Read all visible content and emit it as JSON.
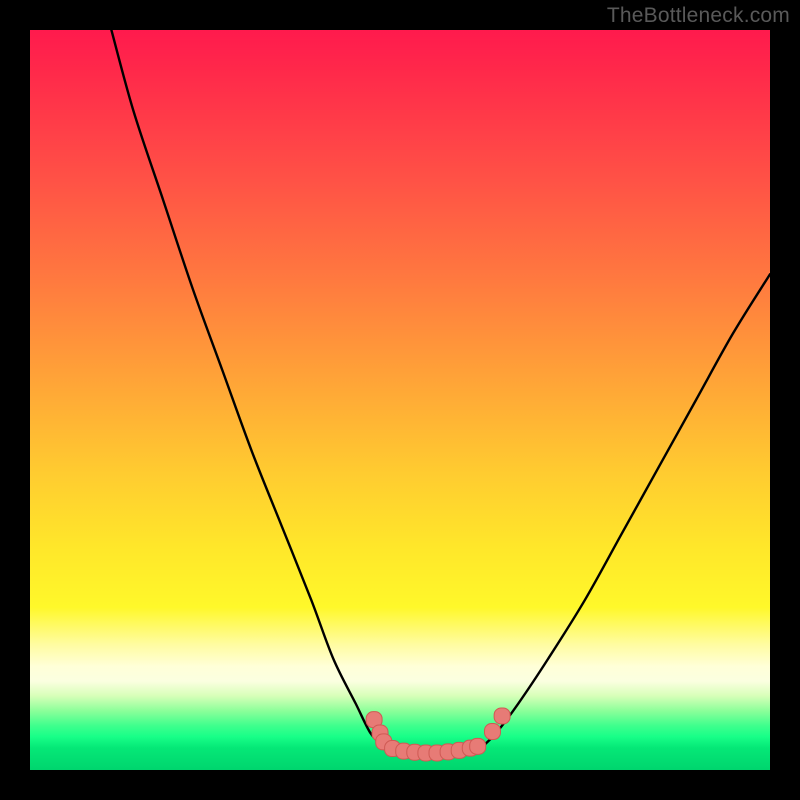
{
  "watermark": "TheBottleneck.com",
  "colors": {
    "frame": "#000000",
    "curve": "#000000",
    "marker_fill": "#e77b76",
    "marker_stroke": "#cf5a54",
    "gradient_top": "#ff1a4d",
    "gradient_mid": "#ffe72a",
    "gradient_bottom": "#00d56e"
  },
  "chart_data": {
    "type": "line",
    "title": "",
    "xlabel": "",
    "ylabel": "",
    "xlim": [
      0,
      100
    ],
    "ylim": [
      0,
      100
    ],
    "note": "Axes have no visible labels/ticks; values are read as percentage of plot area. y=0 is the bottom edge.",
    "series": [
      {
        "name": "left-branch",
        "x": [
          11,
          14,
          18,
          22,
          26,
          30,
          34,
          38,
          41,
          44,
          46,
          47.5
        ],
        "y": [
          100,
          89,
          77,
          65,
          54,
          43,
          33,
          23,
          15,
          9,
          5,
          3.5
        ]
      },
      {
        "name": "right-branch",
        "x": [
          61.5,
          63,
          66,
          70,
          75,
          80,
          85,
          90,
          95,
          100
        ],
        "y": [
          3.5,
          5,
          9,
          15,
          23,
          32,
          41,
          50,
          59,
          67
        ]
      },
      {
        "name": "valley-floor",
        "x": [
          47.5,
          49,
          51,
          53,
          55,
          57,
          59,
          60.5,
          61.5
        ],
        "y": [
          3.5,
          2.9,
          2.5,
          2.3,
          2.3,
          2.5,
          2.8,
          3.1,
          3.5
        ]
      }
    ],
    "markers": {
      "name": "highlighted-points",
      "note": "Salmon rounded markers clustered around the valley minimum and a pair on the right branch just above it.",
      "points": [
        {
          "x": 46.5,
          "y": 6.8
        },
        {
          "x": 47.3,
          "y": 5.0
        },
        {
          "x": 47.8,
          "y": 3.8
        },
        {
          "x": 49.0,
          "y": 2.9
        },
        {
          "x": 50.5,
          "y": 2.55
        },
        {
          "x": 52.0,
          "y": 2.4
        },
        {
          "x": 53.5,
          "y": 2.3
        },
        {
          "x": 55.0,
          "y": 2.3
        },
        {
          "x": 56.5,
          "y": 2.45
        },
        {
          "x": 58.0,
          "y": 2.65
        },
        {
          "x": 59.5,
          "y": 2.95
        },
        {
          "x": 60.5,
          "y": 3.2
        },
        {
          "x": 62.5,
          "y": 5.2
        },
        {
          "x": 63.8,
          "y": 7.3
        }
      ]
    }
  }
}
